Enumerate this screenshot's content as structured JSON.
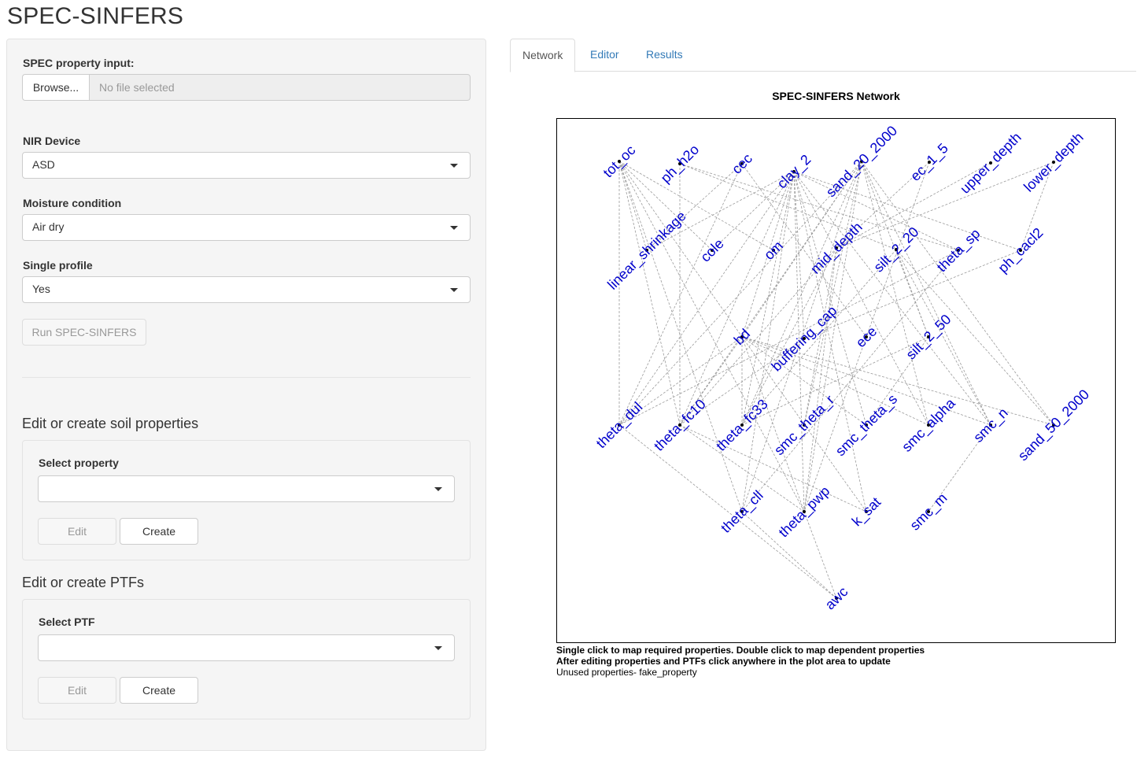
{
  "app": {
    "title": "SPEC-SINFERS"
  },
  "sidebar": {
    "file_label": "SPEC property input:",
    "browse_label": "Browse...",
    "file_placeholder": "No file selected",
    "nir_label": "NIR Device",
    "nir_value": "ASD",
    "moisture_label": "Moisture condition",
    "moisture_value": "Air dry",
    "profile_label": "Single profile",
    "profile_value": "Yes",
    "run_label": "Run SPEC-SINFERS",
    "soil_heading": "Edit or create soil properties",
    "soil_select_label": "Select property",
    "soil_select_value": "",
    "soil_edit_label": "Edit",
    "soil_create_label": "Create",
    "ptf_heading": "Edit or create PTFs",
    "ptf_select_label": "Select PTF",
    "ptf_select_value": "",
    "ptf_edit_label": "Edit",
    "ptf_create_label": "Create"
  },
  "tabs": {
    "network": "Network",
    "editor": "Editor",
    "results": "Results",
    "active": "Network"
  },
  "plot": {
    "title": "SPEC-SINFERS Network",
    "info_line1": "Single click to map required properties. Double click to map dependent properties",
    "info_line2": "After editing properties and PTFs click anywhere in the plot area to update",
    "info_line3": "Unused properties- fake_property",
    "node_color": "#0000cc",
    "edge_color": "#9a9a9a",
    "nodes": [
      "tot_oc",
      "ph_h2o",
      "cec",
      "clay_2",
      "sand_20_2000",
      "ec_1_5",
      "upper_depth",
      "lower_depth",
      "linear_shrinkage",
      "cole",
      "om",
      "mid_depth",
      "silt_2_20",
      "theta_sp",
      "ph_cacl2",
      "bd",
      "buffering_cap",
      "ece",
      "silt_2_50",
      "theta_dul",
      "theta_fc10",
      "theta_fc33",
      "smc_theta_r",
      "smc_theta_s",
      "smc_alpha",
      "smc_n",
      "sand_50_2000",
      "theta_cll",
      "theta_pwp",
      "k_sat",
      "smc_m",
      "awc"
    ],
    "edges": [
      [
        "tot_oc",
        "linear_shrinkage"
      ],
      [
        "tot_oc",
        "theta_dul"
      ],
      [
        "tot_oc",
        "theta_fc10"
      ],
      [
        "tot_oc",
        "om"
      ],
      [
        "tot_oc",
        "bd"
      ],
      [
        "tot_oc",
        "theta_cll"
      ],
      [
        "tot_oc",
        "cole"
      ],
      [
        "tot_oc",
        "theta_pwp"
      ],
      [
        "ph_h2o",
        "theta_fc10"
      ],
      [
        "ph_h2o",
        "silt_2_20"
      ],
      [
        "ph_h2o",
        "theta_sp"
      ],
      [
        "cec",
        "linear_shrinkage"
      ],
      [
        "cec",
        "theta_dul"
      ],
      [
        "cec",
        "ece"
      ],
      [
        "clay_2",
        "linear_shrinkage"
      ],
      [
        "clay_2",
        "cole"
      ],
      [
        "clay_2",
        "theta_dul"
      ],
      [
        "clay_2",
        "theta_fc10"
      ],
      [
        "clay_2",
        "theta_fc33"
      ],
      [
        "clay_2",
        "theta_cll"
      ],
      [
        "clay_2",
        "theta_pwp"
      ],
      [
        "clay_2",
        "k_sat"
      ],
      [
        "clay_2",
        "buffering_cap"
      ],
      [
        "clay_2",
        "ph_cacl2"
      ],
      [
        "clay_2",
        "theta_sp"
      ],
      [
        "clay_2",
        "smc_theta_s"
      ],
      [
        "clay_2",
        "smc_alpha"
      ],
      [
        "clay_2",
        "smc_n"
      ],
      [
        "clay_2",
        "bd"
      ],
      [
        "sand_20_2000",
        "theta_dul"
      ],
      [
        "sand_20_2000",
        "theta_fc10"
      ],
      [
        "sand_20_2000",
        "theta_fc33"
      ],
      [
        "sand_20_2000",
        "bd"
      ],
      [
        "sand_20_2000",
        "smc_theta_r"
      ],
      [
        "sand_20_2000",
        "smc_alpha"
      ],
      [
        "sand_20_2000",
        "smc_n"
      ],
      [
        "sand_20_2000",
        "sand_50_2000"
      ],
      [
        "sand_20_2000",
        "theta_cll"
      ],
      [
        "sand_20_2000",
        "theta_pwp"
      ],
      [
        "sand_20_2000",
        "silt_2_50"
      ],
      [
        "ec_1_5",
        "ece"
      ],
      [
        "ec_1_5",
        "mid_depth"
      ],
      [
        "upper_depth",
        "mid_depth"
      ],
      [
        "lower_depth",
        "mid_depth"
      ],
      [
        "lower_depth",
        "ph_cacl2"
      ],
      [
        "mid_depth",
        "theta_fc10"
      ],
      [
        "mid_depth",
        "theta_fc33"
      ],
      [
        "mid_depth",
        "smc_theta_r"
      ],
      [
        "mid_depth",
        "theta_pwp"
      ],
      [
        "silt_2_20",
        "silt_2_50"
      ],
      [
        "silt_2_20",
        "smc_n"
      ],
      [
        "silt_2_20",
        "sand_50_2000"
      ],
      [
        "silt_2_20",
        "theta_fc33"
      ],
      [
        "theta_sp",
        "theta_dul"
      ],
      [
        "theta_sp",
        "theta_cll"
      ],
      [
        "bd",
        "theta_dul"
      ],
      [
        "bd",
        "theta_fc33"
      ],
      [
        "bd",
        "smc_theta_s"
      ],
      [
        "bd",
        "smc_alpha"
      ],
      [
        "bd",
        "smc_n"
      ],
      [
        "bd",
        "sand_50_2000"
      ],
      [
        "bd",
        "theta_pwp"
      ],
      [
        "bd",
        "k_sat"
      ],
      [
        "bd",
        "theta_fc10"
      ],
      [
        "buffering_cap",
        "theta_fc10"
      ],
      [
        "buffering_cap",
        "ph_cacl2"
      ],
      [
        "ece",
        "theta_pwp"
      ],
      [
        "silt_2_50",
        "smc_theta_s"
      ],
      [
        "silt_2_50",
        "theta_fc33"
      ],
      [
        "theta_dul",
        "awc"
      ],
      [
        "theta_fc10",
        "k_sat"
      ],
      [
        "theta_fc10",
        "theta_pwp"
      ],
      [
        "theta_pwp",
        "awc"
      ],
      [
        "smc_n",
        "smc_m"
      ],
      [
        "theta_cll",
        "awc"
      ]
    ]
  }
}
